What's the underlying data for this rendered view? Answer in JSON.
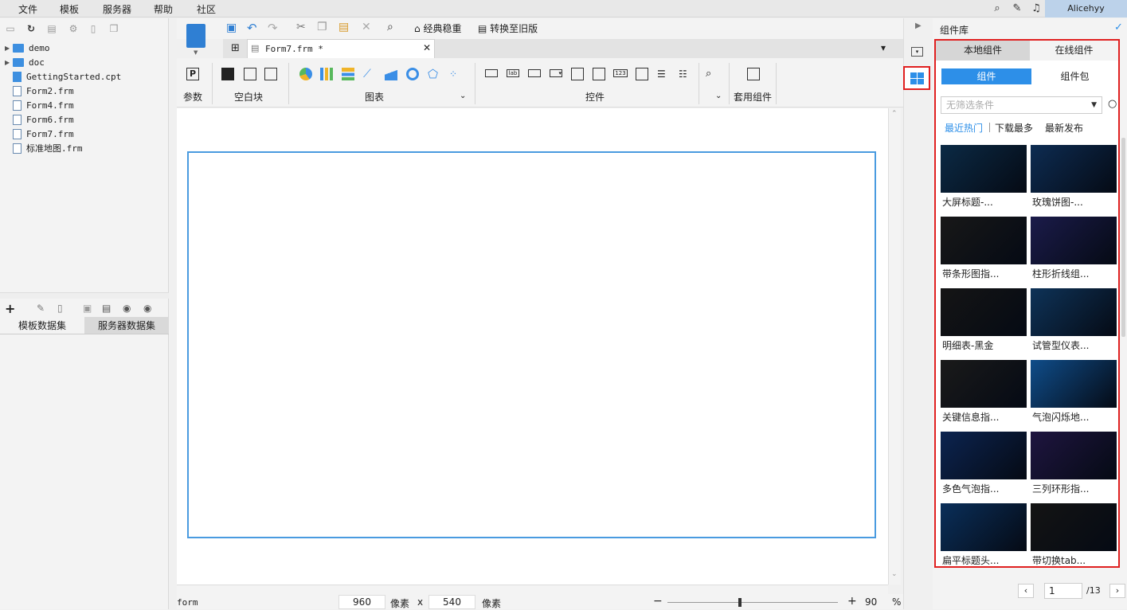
{
  "menu": [
    "文件",
    "模板",
    "服务器",
    "帮助",
    "社区"
  ],
  "user": "Alicehyy",
  "tree": [
    {
      "label": "demo",
      "type": "folder"
    },
    {
      "label": "doc",
      "type": "folder"
    },
    {
      "label": "GettingStarted.cpt",
      "type": "cpt"
    },
    {
      "label": "Form2.frm",
      "type": "frm"
    },
    {
      "label": "Form4.frm",
      "type": "frm"
    },
    {
      "label": "Form6.frm",
      "type": "frm"
    },
    {
      "label": "Form7.frm",
      "type": "frm"
    },
    {
      "label": "标准地图.frm",
      "type": "frm"
    }
  ],
  "dataset_tabs": [
    "模板数据集",
    "服务器数据集"
  ],
  "toolbar": {
    "classic": "经典稳重",
    "convert": "转换至旧版"
  },
  "doc_tab": "Form7.frm *",
  "ribbon": {
    "param": "参数",
    "blank": "空白块",
    "chart": "图表",
    "widget": "控件",
    "apply": "套用组件"
  },
  "status": {
    "name": "form",
    "width": "960",
    "unit1": "像素",
    "x": "x",
    "height": "540",
    "unit2": "像素",
    "zoom": "90",
    "percent": "%"
  },
  "right_panel": {
    "title": "组件库",
    "tabs": [
      "本地组件",
      "在线组件"
    ],
    "subtabs": [
      "组件",
      "组件包"
    ],
    "filter_placeholder": "无筛选条件",
    "sort": [
      "最近热门",
      "下载最多",
      "最新发布"
    ],
    "items": [
      {
        "label": "大屏标题-...",
        "color": "#0b2a45"
      },
      {
        "label": "玫瑰饼图-...",
        "color": "#0d2c52"
      },
      {
        "label": "带条形图指...",
        "color": "#181818"
      },
      {
        "label": "柱形折线组...",
        "color": "#1b1b4a"
      },
      {
        "label": "明细表-黑金",
        "color": "#151515"
      },
      {
        "label": "试管型仪表...",
        "color": "#0e3358"
      },
      {
        "label": "关键信息指...",
        "color": "#1a1a1a"
      },
      {
        "label": "气泡闪烁地...",
        "color": "#0f4d8a"
      },
      {
        "label": "多色气泡指...",
        "color": "#0c2450"
      },
      {
        "label": "三列环形指...",
        "color": "#1f1540"
      },
      {
        "label": "扁平标题头...",
        "color": "#0a2f5a"
      },
      {
        "label": "带切换tab...",
        "color": "#141414"
      }
    ],
    "page": "1",
    "pages": "/13"
  }
}
